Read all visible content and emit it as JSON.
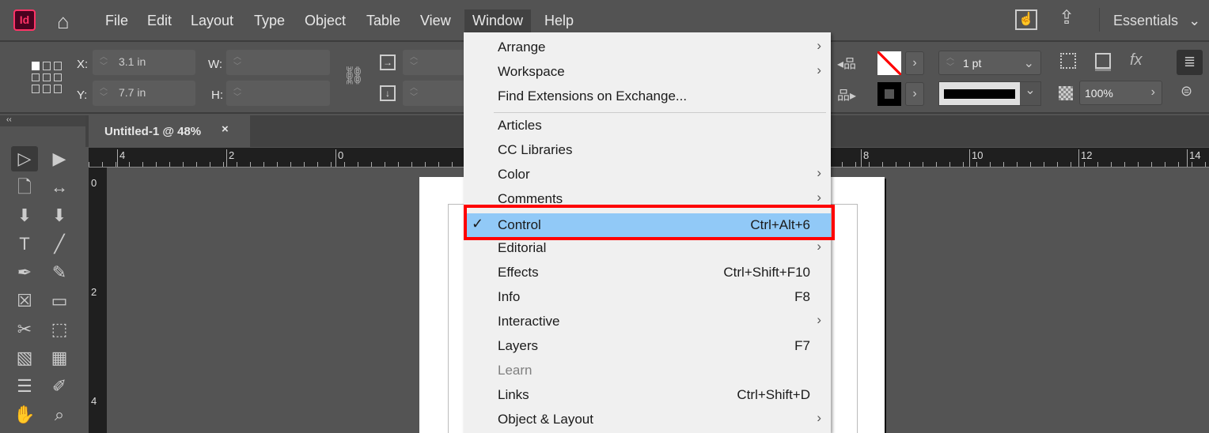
{
  "app": {
    "logo": "Id",
    "workspace": "Essentials"
  },
  "menubar": [
    "File",
    "Edit",
    "Layout",
    "Type",
    "Object",
    "Table",
    "View",
    "Window",
    "Help"
  ],
  "control": {
    "x_label": "X:",
    "x_value": "3.1 in",
    "y_label": "Y:",
    "y_value": "7.7 in",
    "w_label": "W:",
    "h_label": "H:",
    "stroke_weight": "1 pt",
    "opacity": "100%"
  },
  "document_tab": {
    "title": "Untitled-1 @ 48%",
    "close": "×"
  },
  "ruler": {
    "h": [
      "4",
      "2",
      "0",
      "8",
      "10",
      "12",
      "14"
    ],
    "v": [
      "0",
      "2",
      "4"
    ]
  },
  "window_menu": {
    "items": [
      {
        "label": "Arrange",
        "submenu": true
      },
      {
        "label": "Workspace",
        "submenu": true
      },
      {
        "label": "Find Extensions on Exchange..."
      },
      {
        "separator": true
      },
      {
        "label": "Articles"
      },
      {
        "label": "CC Libraries"
      },
      {
        "label": "Color",
        "submenu": true
      },
      {
        "label": "Comments",
        "submenu": true
      },
      {
        "label": "Control",
        "shortcut": "Ctrl+Alt+6",
        "checked": true,
        "highlighted": true
      },
      {
        "label": "Editorial",
        "submenu": true
      },
      {
        "label": "Effects",
        "shortcut": "Ctrl+Shift+F10"
      },
      {
        "label": "Info",
        "shortcut": "F8"
      },
      {
        "label": "Interactive",
        "submenu": true
      },
      {
        "label": "Layers",
        "shortcut": "F7"
      },
      {
        "label": "Learn",
        "disabled": true
      },
      {
        "label": "Links",
        "shortcut": "Ctrl+Shift+D"
      },
      {
        "label": "Object & Layout",
        "submenu": true
      }
    ]
  },
  "colors": {
    "highlight": "#91c9f7",
    "annotation": "#ff0000",
    "brand": "#ff3366"
  }
}
